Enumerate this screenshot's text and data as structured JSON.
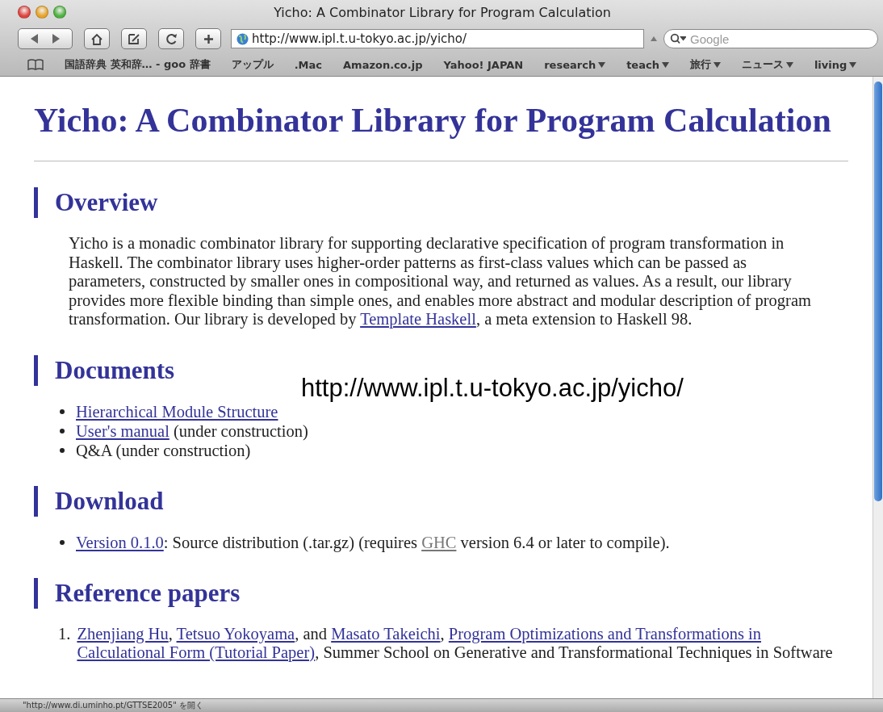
{
  "window": {
    "title": "Yicho: A Combinator Library for Program Calculation"
  },
  "toolbar": {
    "address": "http://www.ipl.t.u-tokyo.ac.jp/yicho/",
    "search_placeholder": "Google"
  },
  "bookmarks": [
    {
      "label": "国語辞典 英和辞… - goo 辞書",
      "menu": false
    },
    {
      "label": "アップル",
      "menu": false
    },
    {
      "label": ".Mac",
      "menu": false
    },
    {
      "label": "Amazon.co.jp",
      "menu": false
    },
    {
      "label": "Yahoo! JAPAN",
      "menu": false
    },
    {
      "label": "research",
      "menu": true
    },
    {
      "label": "teach",
      "menu": true
    },
    {
      "label": "旅行",
      "menu": true
    },
    {
      "label": "ニュース",
      "menu": true
    },
    {
      "label": "living",
      "menu": true
    }
  ],
  "page": {
    "title": "Yicho: A Combinator Library for Program Calculation",
    "sections": [
      {
        "kind": "paragraph",
        "heading": "Overview",
        "segments": [
          {
            "kind": "text",
            "text": "Yicho is a monadic combinator library for supporting declarative specification of program transformation in Haskell. The combinator library uses higher-order patterns as first-class values which can be passed as parameters, constructed by smaller ones in compositional way, and returned as values. As a result, our library provides more flexible binding than simple ones, and enables more abstract and modular description of program transformation. Our library is developed by "
          },
          {
            "kind": "link",
            "text": "Template Haskell"
          },
          {
            "kind": "text",
            "text": ", a meta extension to Haskell 98."
          }
        ]
      },
      {
        "kind": "bullets",
        "heading": "Documents",
        "items": [
          [
            {
              "kind": "link",
              "text": "Hierarchical Module Structure"
            }
          ],
          [
            {
              "kind": "link",
              "text": "User's manual"
            },
            {
              "kind": "text",
              "text": " (under construction)"
            }
          ],
          [
            {
              "kind": "text",
              "text": "Q&A (under construction)"
            }
          ]
        ]
      },
      {
        "kind": "bullets",
        "heading": "Download",
        "items": [
          [
            {
              "kind": "link",
              "text": "Version 0.1.0"
            },
            {
              "kind": "text",
              "text": ": Source distribution (.tar.gz) (requires "
            },
            {
              "kind": "visited",
              "text": "GHC"
            },
            {
              "kind": "text",
              "text": " version 6.4 or later to compile)."
            }
          ]
        ]
      },
      {
        "kind": "numbered",
        "heading": "Reference papers",
        "items": [
          {
            "number": "1.",
            "lines": [
              [
                {
                  "kind": "link",
                  "text": "Zhenjiang Hu"
                },
                {
                  "kind": "text",
                  "text": ", "
                },
                {
                  "kind": "link",
                  "text": "Tetsuo Yokoyama"
                },
                {
                  "kind": "text",
                  "text": ", and "
                },
                {
                  "kind": "link",
                  "text": "Masato Takeichi"
                },
                {
                  "kind": "text",
                  "text": ", "
                },
                {
                  "kind": "link",
                  "text": "Program Optimizations and Transformations in"
                }
              ],
              [
                {
                  "kind": "link",
                  "text": "Calculational Form (Tutorial Paper)"
                },
                {
                  "kind": "text",
                  "text": ", Summer School on Generative and Transformational Techniques in Software"
                }
              ]
            ]
          }
        ]
      }
    ]
  },
  "caption": "http://www.ipl.t.u-tokyo.ac.jp/yicho/",
  "status_bar": "\"http://www.di.uminho.pt/GTTSE2005\" を開く"
}
